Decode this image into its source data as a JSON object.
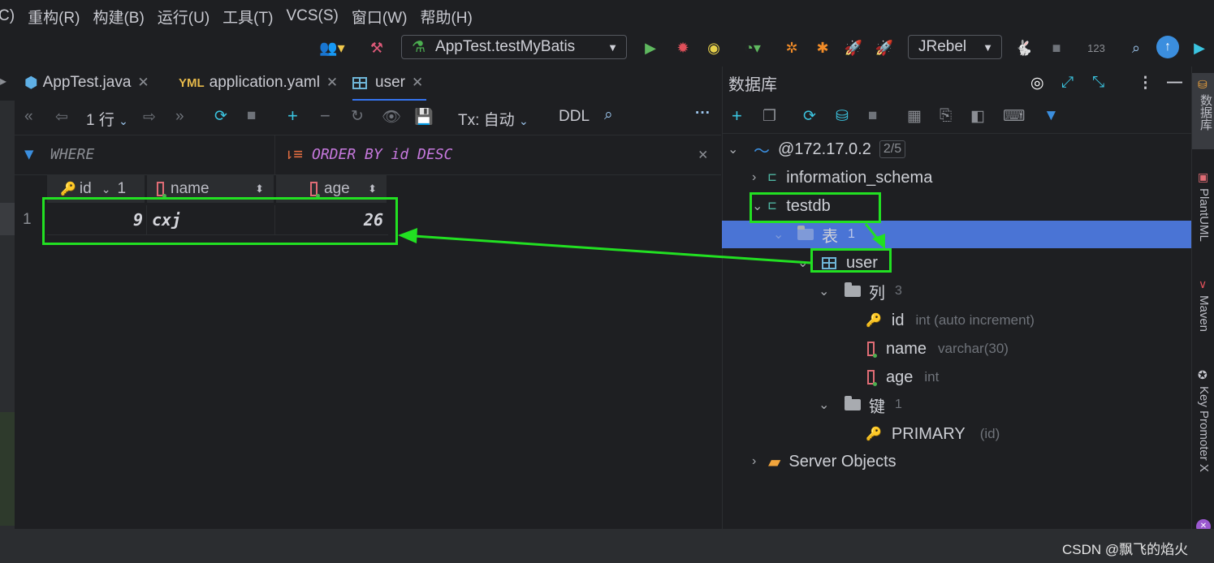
{
  "menu": [
    "C)",
    "重构(R)",
    "构建(B)",
    "运行(U)",
    "工具(T)",
    "VCS(S)",
    "窗口(W)",
    "帮助(H)"
  ],
  "toolbar": {
    "run_config": "AppTest.testMyBatis",
    "jrebel": "JRebel",
    "counter": "123"
  },
  "tabs": [
    {
      "label": "AppTest.java"
    },
    {
      "label": "application.yaml"
    },
    {
      "label": "user"
    }
  ],
  "grid": {
    "rows_label": "1 行",
    "tx_label": "Tx: 自动",
    "ddl_label": "DDL",
    "where_label": "WHERE",
    "order_label": "ORDER BY id DESC",
    "columns": [
      {
        "name": "id",
        "sort": "1"
      },
      {
        "name": "name"
      },
      {
        "name": "age"
      }
    ],
    "rows": [
      {
        "num": "1",
        "id": "9",
        "name": "cxj",
        "age": "26"
      }
    ]
  },
  "db": {
    "title": "数据库",
    "host": "@172.17.0.2",
    "host_count": "2/5",
    "schema1": "information_schema",
    "schema2": "testdb",
    "tables_folder": "表",
    "tables_count": "1",
    "table": "user",
    "cols_folder": "列",
    "cols_count": "3",
    "columns": [
      {
        "name": "id",
        "type": "int (auto increment)"
      },
      {
        "name": "name",
        "type": "varchar(30)"
      },
      {
        "name": "age",
        "type": "int"
      }
    ],
    "keys_folder": "键",
    "keys_count": "1",
    "key_name": "PRIMARY",
    "key_cols": "(id)",
    "server_objects": "Server Objects"
  },
  "right_tools": [
    "数据库",
    "PlantUML",
    "Maven",
    "Key Promoter X"
  ],
  "watermark": "CSDN @飘飞的焰火",
  "colors": {
    "accent": "#3574f0",
    "highlight": "#22e022",
    "selection": "#4a74d5"
  }
}
